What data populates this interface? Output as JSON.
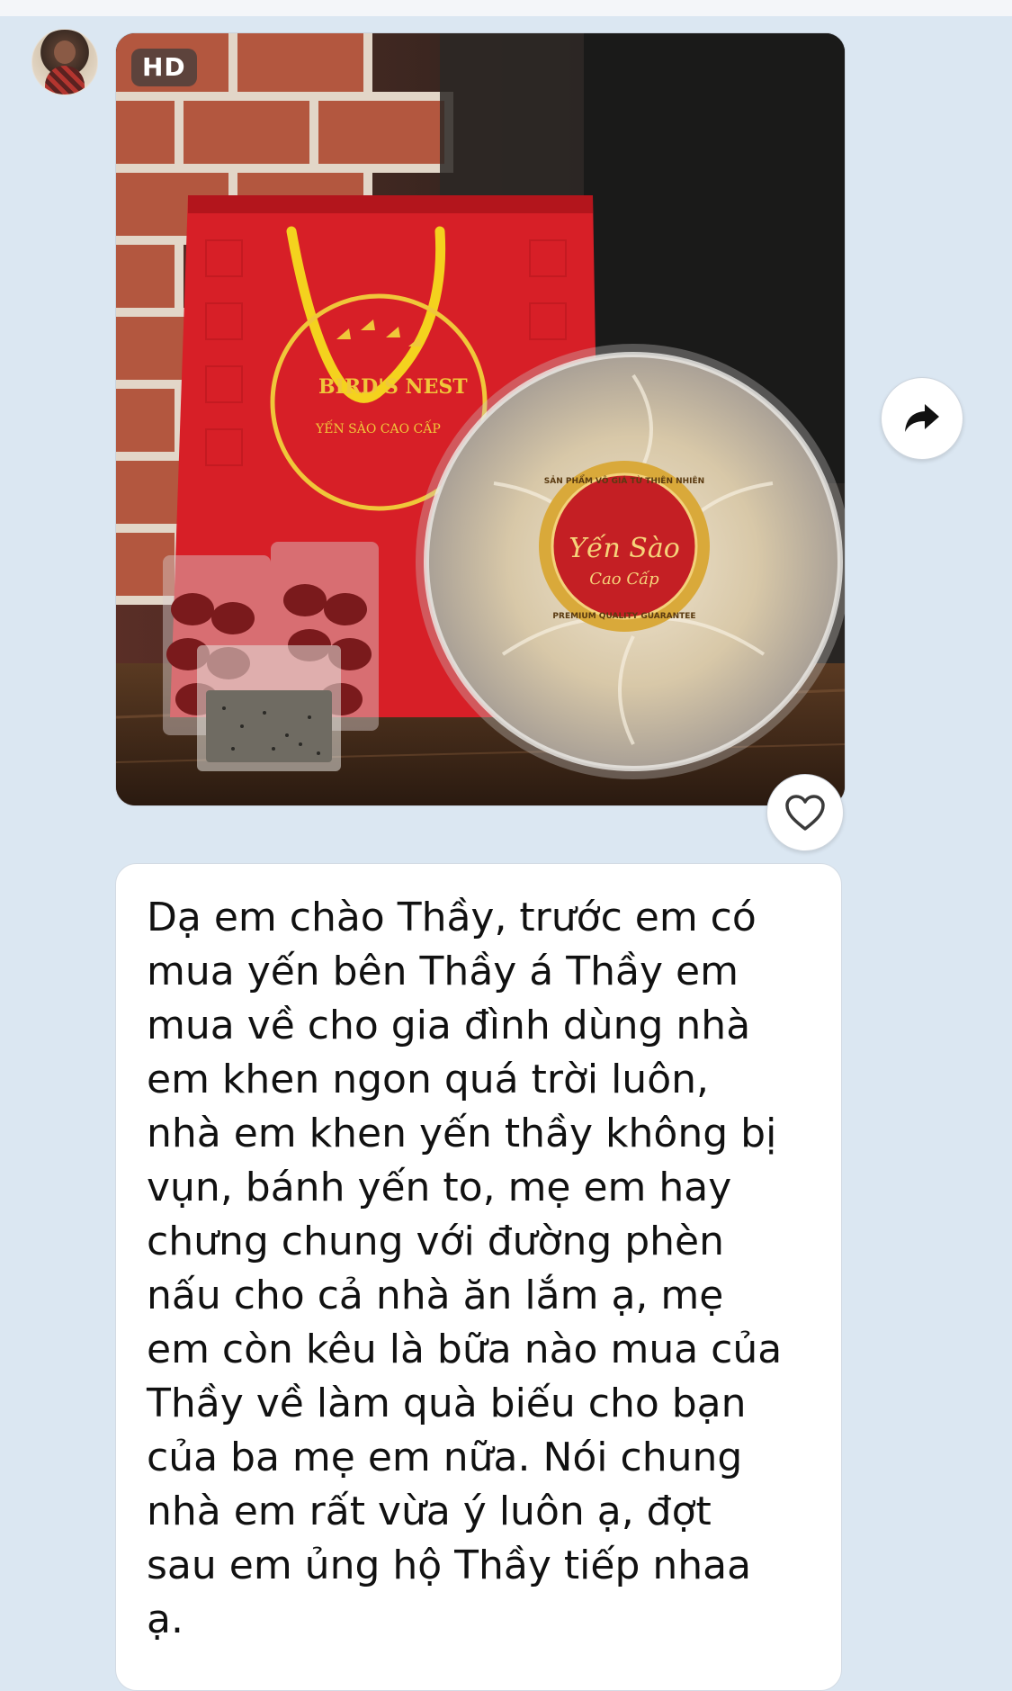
{
  "chat": {
    "sender_avatar": "avatar",
    "photo_message": {
      "badge": "HD",
      "product_labels": {
        "bag_logo_line1": "BIRD'S NEST",
        "bag_logo_line2": "YẾN SÀO CAO CẤP",
        "seal_arc_top": "SẢN PHẨM VÔ GIÁ TỪ THIÊN NHIÊN",
        "seal_title": "Yến Sào",
        "seal_subtitle": "Cao Cấp",
        "seal_arc_bottom": "PREMIUM QUALITY GUARANTEE"
      },
      "share_icon": "share-arrow-icon",
      "like_icon": "heart-outline-icon"
    },
    "text_message": {
      "text": "Dạ em chào Thầy, trước em có\nmua yến bên Thầy á Thầy em\nmua về cho gia đình dùng nhà\nem khen ngon quá trời luôn,\nnhà em khen yến thầy không bị\nvụn, bánh yến to, mẹ em hay\nchưng chung với đường phèn\nnấu cho cả nhà ăn lắm ạ, mẹ\nem còn kêu là bữa nào mua của\nThầy về làm quà biếu cho bạn\ncủa ba mẹ em nữa. Nói chung\nnhà em rất vừa ý luôn ạ, đợt\nsau em ủng hộ Thầy tiếp nhaa\nạ."
    }
  },
  "colors": {
    "chat_background": "#dbe7f2",
    "bubble": "#ffffff",
    "bag_red": "#e0242b",
    "seal_gold": "#d9a93a"
  }
}
